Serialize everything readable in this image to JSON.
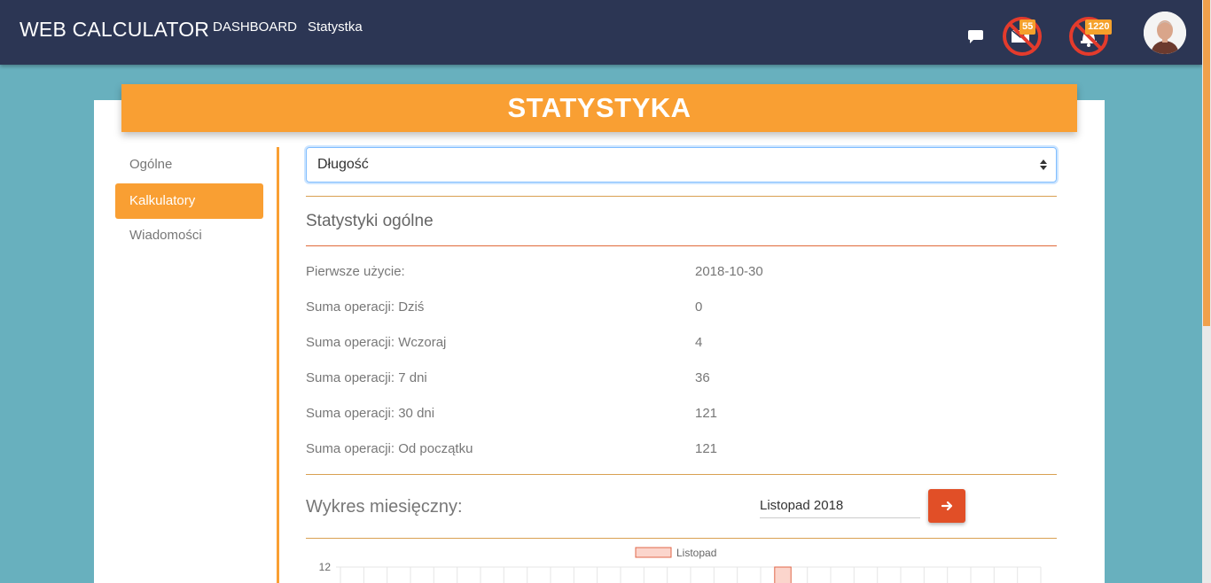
{
  "navbar": {
    "brand": "WEB CALCULATOR",
    "links": [
      "DASHBOARD",
      "Statystka"
    ],
    "mail_badge": "55",
    "bell_badge": "1220"
  },
  "page": {
    "title": "STATYSTYKA"
  },
  "sidebar": {
    "items": [
      {
        "label": "Ogólne",
        "active": false
      },
      {
        "label": "Kalkulatory",
        "active": true
      },
      {
        "label": "Wiadomości",
        "active": false
      }
    ]
  },
  "calculator_select": {
    "value": "Długość"
  },
  "general_stats": {
    "title": "Statystyki ogólne",
    "rows": [
      {
        "label": "Pierwsze użycie:",
        "value": "2018-10-30"
      },
      {
        "label": "Suma operacji: Dziś",
        "value": "0"
      },
      {
        "label": "Suma operacji: Wczoraj",
        "value": "4"
      },
      {
        "label": "Suma operacji: 7 dni",
        "value": "36"
      },
      {
        "label": "Suma operacji: 30 dni",
        "value": "121"
      },
      {
        "label": "Suma operacji: Od początku",
        "value": "121"
      }
    ]
  },
  "monthly_chart": {
    "title": "Wykres miesięczny:",
    "month_value": "Listopad 2018"
  },
  "chart_data": {
    "type": "bar",
    "legend": [
      "Listopad"
    ],
    "y_tick_labels": [
      "12"
    ],
    "ylim_visible_top": 12,
    "series": [
      {
        "name": "Listopad",
        "color_fill": "#fbd5cc",
        "color_border": "#e0674a"
      }
    ]
  },
  "colors": {
    "navbar": "#2c3654",
    "accent": "#f99f33",
    "button": "#e14f27",
    "background": "#68b0be"
  }
}
